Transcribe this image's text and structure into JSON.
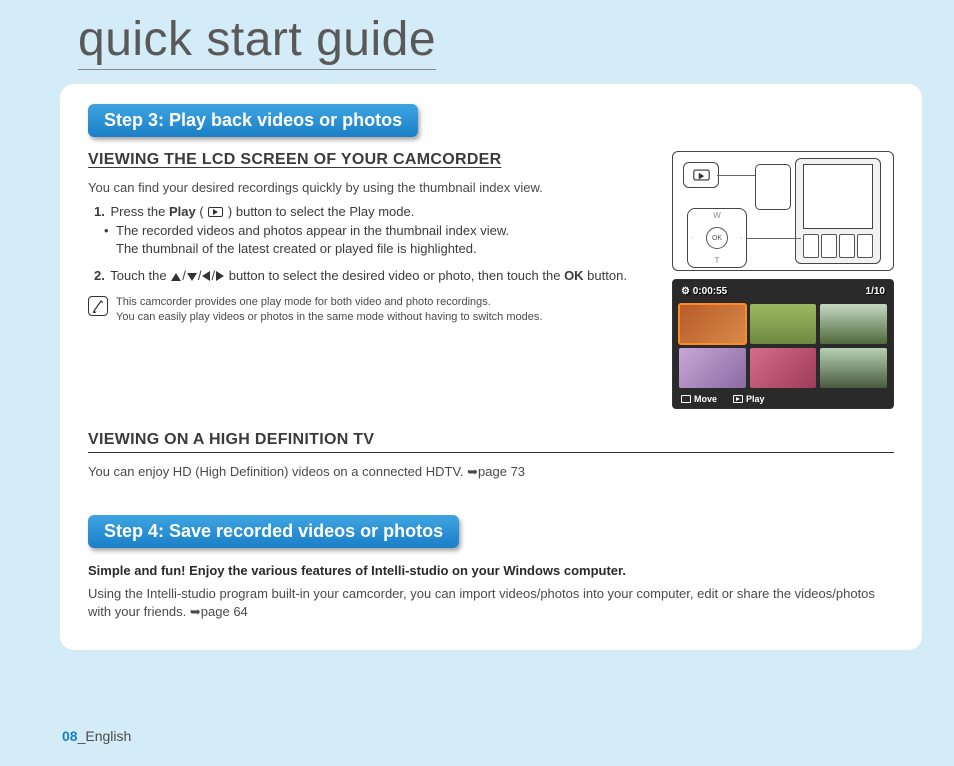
{
  "header": {
    "title": "quick start guide"
  },
  "step3": {
    "pill": "Step 3: Play back videos or photos",
    "heading1": "VIEWING THE LCD SCREEN OF YOUR CAMCORDER",
    "intro": "You can find your desired recordings quickly by using the thumbnail index view.",
    "item1_a": "Press the ",
    "item1_b": "Play",
    "item1_c": " ( ",
    "item1_d": " ) button to select the Play mode.",
    "item1_sub_a": "The recorded videos and photos appear in the thumbnail index view.",
    "item1_sub_b": "The thumbnail of the latest created or played file is highlighted.",
    "item2_a": "Touch the ",
    "item2_b": " button to select the desired video or photo, then touch the ",
    "item2_c": "OK",
    "item2_d": " button.",
    "note_a": "This camcorder provides one play mode for both video and photo recordings.",
    "note_b": "You can easily play videos or photos in the same mode without having to switch modes.",
    "heading2": "VIEWING ON A HIGH DEFINITION TV",
    "tv_text_a": "You can enjoy HD (High Definition) videos on a connected HDTV. ",
    "tv_text_b": "page 73"
  },
  "step4": {
    "pill": "Step 4: Save recorded videos or photos",
    "bold_line": "Simple and fun! Enjoy the various features of Intelli-studio on your Windows computer.",
    "body_a": "Using the Intelli-studio program built-in your camcorder, you can import videos/photos into your computer, edit or share the videos/photos with your friends. ",
    "body_b": "page 64"
  },
  "diagram": {
    "dpad_ok": "OK",
    "dpad_w": "W",
    "dpad_t": "T"
  },
  "lcd": {
    "time": "0:00:55",
    "count": "1/10",
    "move": "Move",
    "play": "Play"
  },
  "footer": {
    "pagenum": "08",
    "lang": "English"
  }
}
